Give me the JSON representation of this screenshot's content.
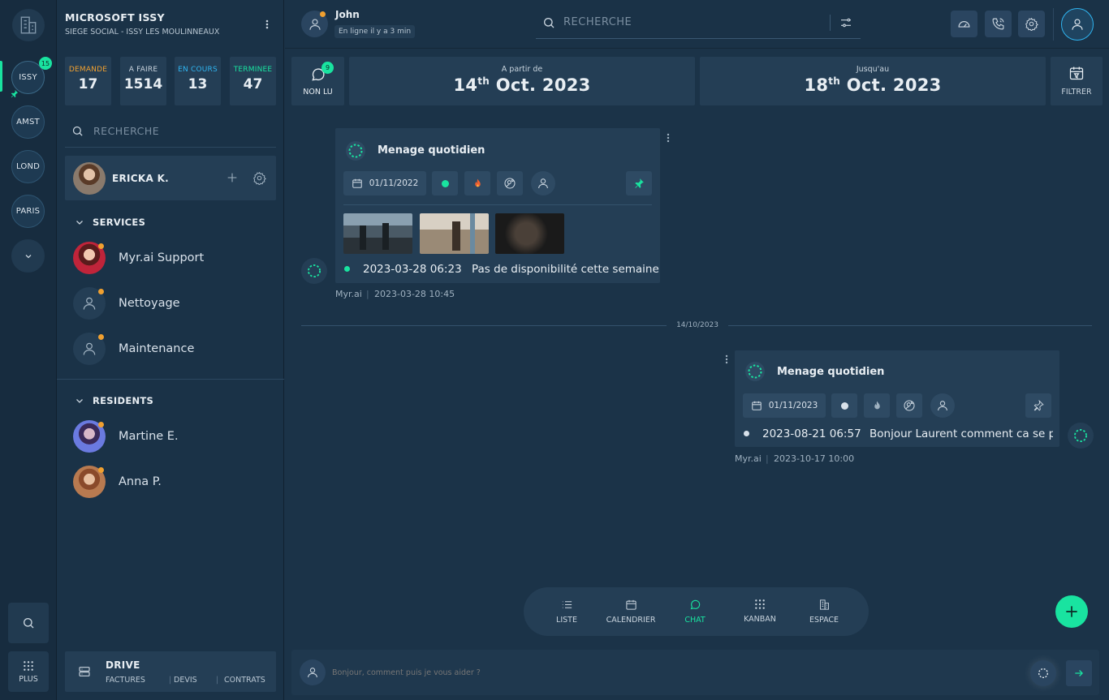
{
  "rail": {
    "sites": [
      {
        "label": "ISSY",
        "badge": "15"
      },
      {
        "label": "AMST"
      },
      {
        "label": "LOND"
      },
      {
        "label": "PARIS"
      }
    ],
    "plus_label": "PLUS"
  },
  "sidebar": {
    "org_name": "MICROSOFT ISSY",
    "org_subtitle": "SIEGE SOCIAL - ISSY LES MOULINNEAUX",
    "stats": [
      {
        "label": "DEMANDE",
        "value": "17",
        "color": "#f0a030"
      },
      {
        "label": "A FAIRE",
        "value": "1514",
        "color": "#c9d4de"
      },
      {
        "label": "EN COURS",
        "value": "13",
        "color": "#2fb4f0"
      },
      {
        "label": "TERMINEE",
        "value": "47",
        "color": "#19e3a0"
      }
    ],
    "search_placeholder": "RECHERCHE",
    "current_user": "ERICKA K.",
    "services_header": "SERVICES",
    "services": [
      "Myr.ai Support",
      "Nettoyage",
      "Maintenance"
    ],
    "residents_header": "RESIDENTS",
    "residents": [
      "Martine E.",
      "Anna P."
    ],
    "drive": {
      "title": "DRIVE",
      "links": [
        "FACTURES",
        "DEVIS",
        "CONTRATS"
      ]
    }
  },
  "header": {
    "user_name": "John",
    "user_status": "En ligne il y a 3 min",
    "search_placeholder": "RECHERCHE"
  },
  "filters": {
    "unread_label": "NON LU",
    "unread_count": "9",
    "from_label": "A partir de",
    "from_day": "14",
    "from_suffix": "th",
    "from_rest": "Oct. 2023",
    "to_label": "Jusqu'au",
    "to_day": "18",
    "to_suffix": "th",
    "to_rest": "Oct. 2023",
    "filter_label": "FILTRER"
  },
  "messages": [
    {
      "title": "Menage quotidien",
      "date": "01/11/2022",
      "entry_time": "2023-03-28 06:23",
      "entry_text": "Pas de disponibilité cette semaine",
      "author": "Myr.ai",
      "timestamp": "2023-03-28 10:45"
    },
    {
      "title": "Menage quotidien",
      "date": "01/11/2023",
      "entry_time": "2023-08-21 06:57",
      "entry_text": "Bonjour Laurent comment ca se p",
      "author": "Myr.ai",
      "timestamp": "2023-10-17 10:00"
    }
  ],
  "day_separator": "14/10/2023",
  "bottom_nav": [
    "LISTE",
    "CALENDRIER",
    "CHAT",
    "KANBAN",
    "ESPACE"
  ],
  "composer": {
    "placeholder": "Bonjour, comment puis je vous aider ?"
  },
  "colors": {
    "accent": "#19e3a0",
    "warning": "#f0a030",
    "info": "#2fb4f0",
    "background": "#1b3348",
    "panel": "#243e55"
  }
}
